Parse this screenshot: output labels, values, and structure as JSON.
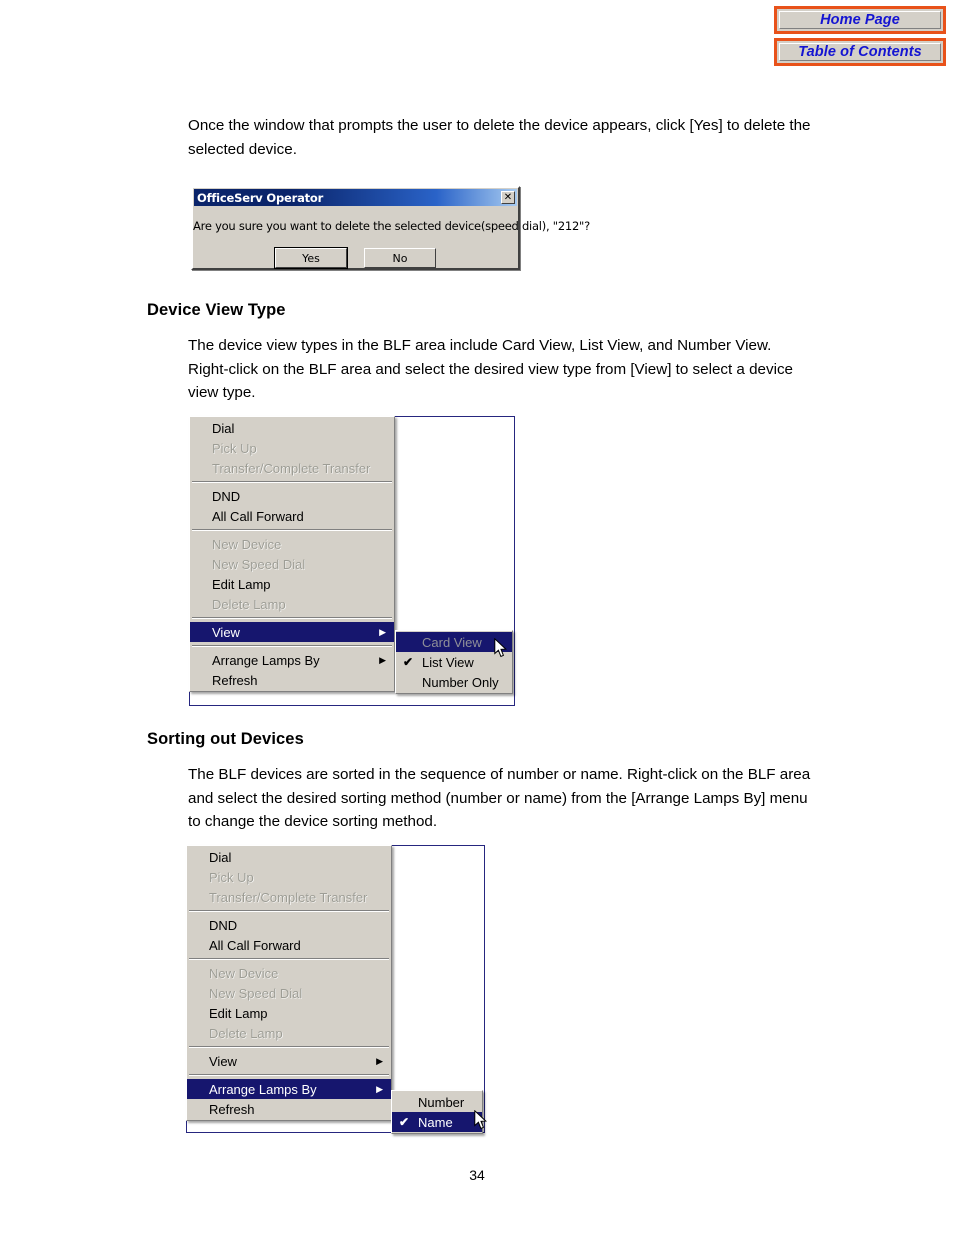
{
  "nav": {
    "buttons": [
      {
        "label": "Home Page",
        "name": "home-page-button"
      },
      {
        "label": "Table of Contents",
        "name": "table-of-contents-button"
      }
    ],
    "border_color": "#e8521a",
    "text_color": "#1414d2"
  },
  "intro_paragraph": {
    "line1": "Once the window that prompts the user to delete the device appears, click [Yes] to delete the",
    "line2": "selected device."
  },
  "dialog": {
    "title": "OfficeServ Operator",
    "close_glyph": "✕",
    "message": "Are you sure you want to delete the selected device(speed dial), \"212\"?",
    "buttons": [
      {
        "label": "Yes",
        "default": true
      },
      {
        "label": "No",
        "default": false
      }
    ]
  },
  "section_device_view": {
    "heading": "Device View Type",
    "line1": "The device view types in the BLF area include Card View, List View, and Number View.",
    "line2": "Right-click on the BLF area and select the desired view type from [View] to select a device",
    "line3": "view type."
  },
  "section_sorting": {
    "heading": "Sorting out Devices",
    "line1": "The BLF devices are sorted in the sequence of number or name. Right-click on the BLF area",
    "line2": "and select the desired sorting method (number or name) from the [Arrange Lamps By] menu",
    "line3": "to change the device sorting method."
  },
  "context_menu_view": {
    "items": [
      {
        "label": "Dial",
        "state": "enabled",
        "submenu": false
      },
      {
        "label": "Pick Up",
        "state": "disabled",
        "submenu": false
      },
      {
        "label": "Transfer/Complete Transfer",
        "state": "disabled",
        "submenu": false
      },
      {
        "separator": true
      },
      {
        "label": "DND",
        "state": "enabled",
        "submenu": false
      },
      {
        "label": "All Call Forward",
        "state": "enabled",
        "submenu": false
      },
      {
        "separator": true
      },
      {
        "label": "New Device",
        "state": "disabled",
        "submenu": false
      },
      {
        "label": "New Speed Dial",
        "state": "disabled",
        "submenu": false
      },
      {
        "label": "Edit Lamp",
        "state": "enabled",
        "submenu": false
      },
      {
        "label": "Delete Lamp",
        "state": "disabled",
        "submenu": false
      },
      {
        "separator": true
      },
      {
        "label": "View",
        "state": "selected",
        "submenu": true
      },
      {
        "separator": true
      },
      {
        "label": "Arrange Lamps By",
        "state": "enabled",
        "submenu": true
      },
      {
        "label": "Refresh",
        "state": "enabled",
        "submenu": false
      }
    ],
    "submenu": {
      "items": [
        {
          "label": "Card View",
          "state": "selected-disabled",
          "checked": false
        },
        {
          "label": "List View",
          "state": "enabled",
          "checked": true
        },
        {
          "label": "Number Only",
          "state": "enabled",
          "checked": false
        }
      ]
    }
  },
  "context_menu_arrange": {
    "items": [
      {
        "label": "Dial",
        "state": "enabled",
        "submenu": false
      },
      {
        "label": "Pick Up",
        "state": "disabled",
        "submenu": false
      },
      {
        "label": "Transfer/Complete Transfer",
        "state": "disabled",
        "submenu": false
      },
      {
        "separator": true
      },
      {
        "label": "DND",
        "state": "enabled",
        "submenu": false
      },
      {
        "label": "All Call Forward",
        "state": "enabled",
        "submenu": false
      },
      {
        "separator": true
      },
      {
        "label": "New Device",
        "state": "disabled",
        "submenu": false
      },
      {
        "label": "New Speed Dial",
        "state": "disabled",
        "submenu": false
      },
      {
        "label": "Edit Lamp",
        "state": "enabled",
        "submenu": false
      },
      {
        "label": "Delete Lamp",
        "state": "disabled",
        "submenu": false
      },
      {
        "separator": true
      },
      {
        "label": "View",
        "state": "enabled",
        "submenu": true
      },
      {
        "separator": true
      },
      {
        "label": "Arrange Lamps By",
        "state": "selected",
        "submenu": true
      },
      {
        "label": "Refresh",
        "state": "enabled",
        "submenu": false
      }
    ],
    "submenu": {
      "items": [
        {
          "label": "Number",
          "state": "enabled",
          "checked": false
        },
        {
          "label": "Name",
          "state": "selected",
          "checked": true
        }
      ]
    }
  },
  "icons": {
    "submenu_arrow": "▶",
    "checkmark": "✔"
  },
  "page_number": "34"
}
